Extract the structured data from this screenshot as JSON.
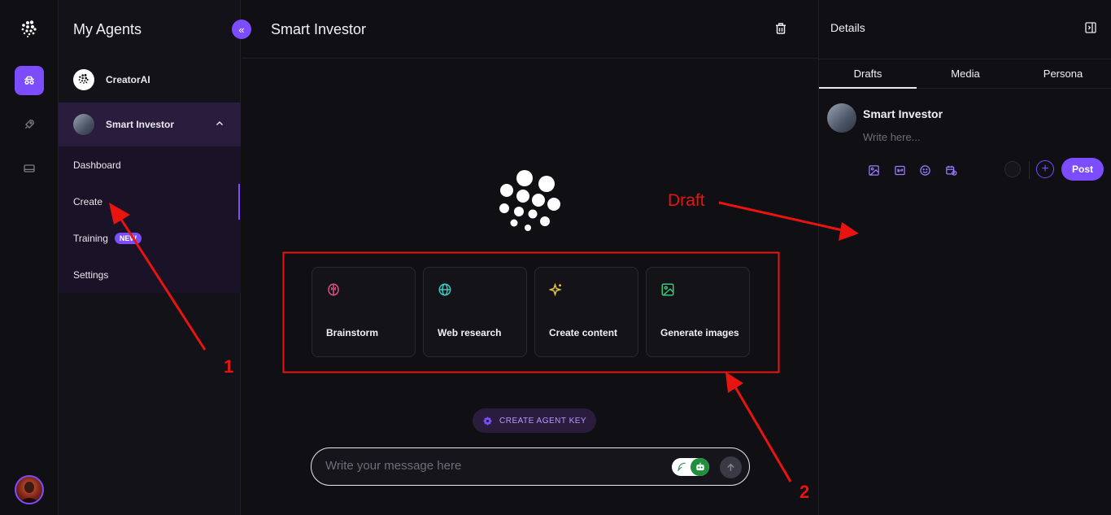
{
  "sidebar": {
    "title": "My Agents",
    "collapse_icon": "«",
    "agents": [
      {
        "name": "CreatorAI"
      },
      {
        "name": "Smart Investor"
      }
    ],
    "submenu": {
      "dashboard": "Dashboard",
      "create": "Create",
      "training": "Training",
      "training_badge": "NEW",
      "settings": "Settings"
    }
  },
  "main": {
    "title": "Smart Investor",
    "actions": [
      {
        "label": "Brainstorm",
        "icon": "brain-icon",
        "color": "#e0508c"
      },
      {
        "label": "Web research",
        "icon": "globe-icon",
        "color": "#3ec7c2"
      },
      {
        "label": "Create content",
        "icon": "sparkles-icon",
        "color": "#e8c23a"
      },
      {
        "label": "Generate images",
        "icon": "image-icon",
        "color": "#38c77a"
      }
    ],
    "agent_key_label": "CREATE AGENT KEY",
    "message_placeholder": "Write your message here"
  },
  "details": {
    "title": "Details",
    "tabs": [
      "Drafts",
      "Media",
      "Persona"
    ],
    "active_tab": "Drafts",
    "post_author": "Smart Investor",
    "post_placeholder": "Write here...",
    "post_button": "Post",
    "tool_icons": [
      "image-icon",
      "gif-icon",
      "emoji-icon",
      "schedule-icon"
    ]
  },
  "annotations": {
    "label_1": "1",
    "label_2": "2",
    "draft": "Draft",
    "color": "#e8140f"
  },
  "colors": {
    "accent": "#7c4dff",
    "background": "#0f0f14",
    "selected_agent": "#2a1c3c"
  }
}
